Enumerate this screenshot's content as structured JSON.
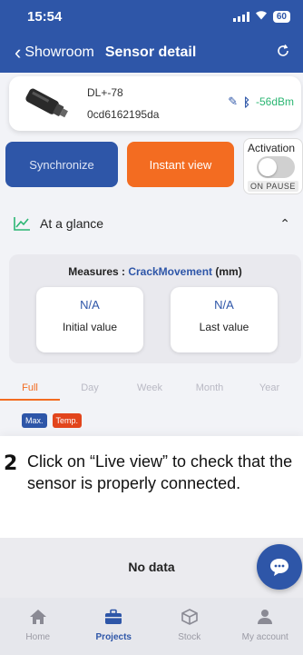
{
  "status_bar": {
    "time": "15:54",
    "wifi_icon": "wifi-icon",
    "battery": "60"
  },
  "app_bar": {
    "back_label": "Showroom",
    "title": "Sensor detail",
    "sync_icon": "refresh-icon"
  },
  "sensor": {
    "name": "DL+-78",
    "id": "0cd6162195da",
    "rssi": "-56dBm"
  },
  "actions": {
    "synchronize": "Synchronize",
    "instant_view": "Instant view",
    "activation_label": "Activation",
    "activation_state": "ON PAUSE"
  },
  "glance": {
    "label": "At a glance"
  },
  "measures": {
    "prefix": "Measures : ",
    "metric": "CrackMovement",
    "unit": " (mm)",
    "initial": {
      "value": "N/A",
      "label": "Initial value"
    },
    "last": {
      "value": "N/A",
      "label": "Last value"
    }
  },
  "tabs": [
    "Full",
    "Day",
    "Week",
    "Month",
    "Year"
  ],
  "tags": {
    "max": "Max.",
    "temp": "Temp."
  },
  "overlay": {
    "step": "2",
    "text": "Click on “Live view” to check that the sensor is properly connected."
  },
  "chart_area": {
    "no_data": "No data"
  },
  "bottom_nav": {
    "home": "Home",
    "projects": "Projects",
    "stock": "Stock",
    "account": "My account"
  },
  "colors": {
    "primary": "#2e56a8",
    "accent": "#f36c21",
    "success": "#2bb673",
    "temp_tag": "#e2451c"
  }
}
